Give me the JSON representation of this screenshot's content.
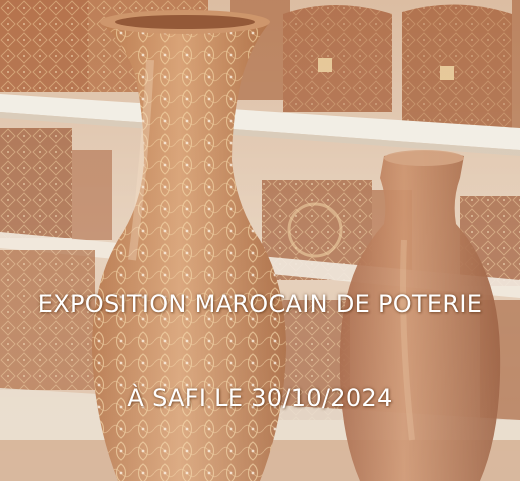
{
  "poster": {
    "headline": "EXPOSITION MAROCAIN DE POTERIE",
    "subline": "À SAFI LE 30/10/2024",
    "text_color": "#ffffff"
  },
  "palette": {
    "shelf": "#f1ece2",
    "wood_light": "#c6875a",
    "wood_dark": "#8a4a26",
    "pattern": "#f2cf9a"
  }
}
